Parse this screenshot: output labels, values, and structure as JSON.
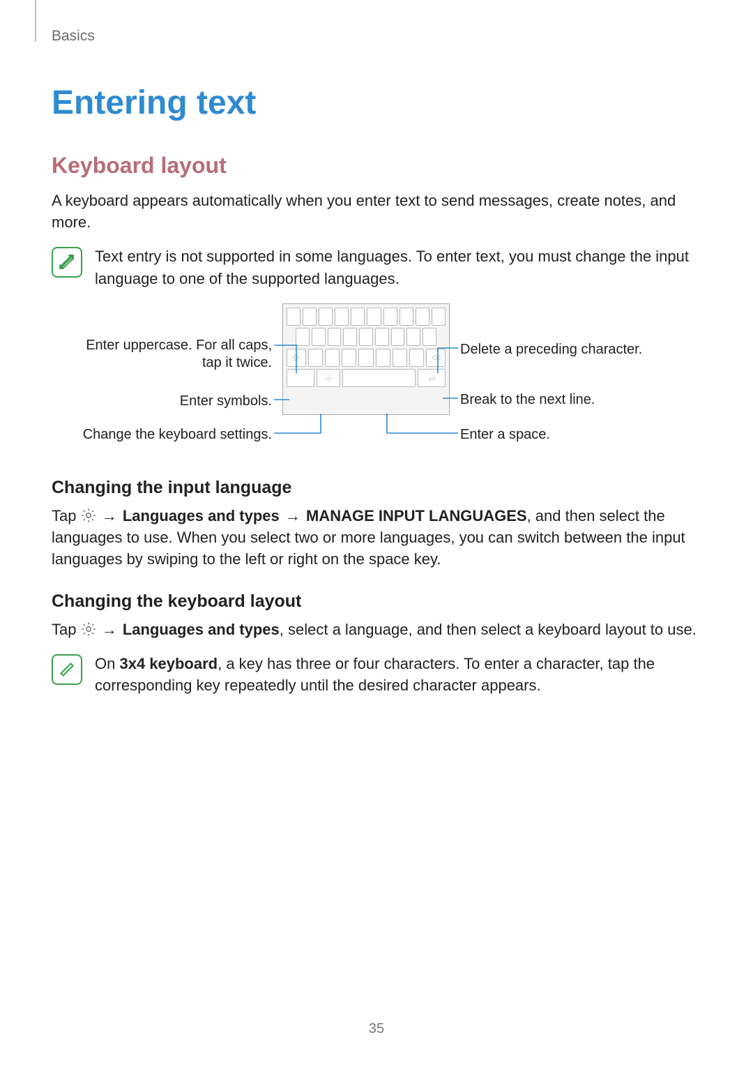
{
  "header": {
    "section": "Basics"
  },
  "title": "Entering text",
  "sub1": {
    "heading": "Keyboard layout",
    "intro": "A keyboard appears automatically when you enter text to send messages, create notes, and more.",
    "note": "Text entry is not supported in some languages. To enter text, you must change the input language to one of the supported languages."
  },
  "diagram": {
    "left": {
      "uppercase": "Enter uppercase. For all caps, tap it twice.",
      "symbols": "Enter symbols.",
      "settings": "Change the keyboard settings."
    },
    "right": {
      "delete": "Delete a preceding character.",
      "newline": "Break to the next line.",
      "space": "Enter a space."
    }
  },
  "input_lang": {
    "heading": "Changing the input language",
    "pre": "Tap ",
    "arrow": " → ",
    "bold1": "Languages and types",
    "bold2": "MANAGE INPUT LANGUAGES",
    "post": ", and then select the languages to use. When you select two or more languages, you can switch between the input languages by swiping to the left or right on the space key."
  },
  "kbd_layout": {
    "heading": "Changing the keyboard layout",
    "pre": "Tap ",
    "arrow": " → ",
    "bold1": "Languages and types",
    "post": ", select a language, and then select a keyboard layout to use.",
    "note_pre": "On ",
    "note_bold": "3x4 keyboard",
    "note_post": ", a key has three or four characters. To enter a character, tap the corresponding key repeatedly until the desired character appears."
  },
  "page_number": "35"
}
